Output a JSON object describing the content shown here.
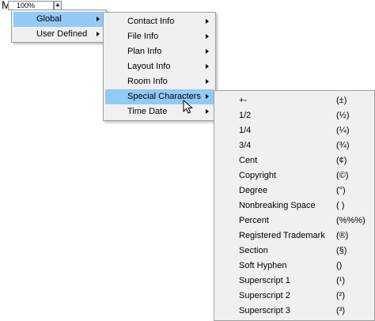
{
  "toolbar": {
    "glyph": "M",
    "zoom_value": "100%",
    "spin_glyph": "▲"
  },
  "menus": {
    "level1": {
      "items": [
        {
          "label": "Global",
          "highlighted": true,
          "submenu": true
        },
        {
          "label": "User Defined",
          "highlighted": false,
          "submenu": true
        }
      ]
    },
    "level2": {
      "items": [
        {
          "label": "Contact Info",
          "highlighted": false,
          "submenu": true
        },
        {
          "label": "File Info",
          "highlighted": false,
          "submenu": true
        },
        {
          "label": "Plan Info",
          "highlighted": false,
          "submenu": true
        },
        {
          "label": "Layout Info",
          "highlighted": false,
          "submenu": true
        },
        {
          "label": "Room Info",
          "highlighted": false,
          "submenu": true
        },
        {
          "label": "Special Characters",
          "highlighted": true,
          "submenu": true
        },
        {
          "label": "Time  Date",
          "highlighted": false,
          "submenu": true
        }
      ]
    },
    "level3": {
      "items": [
        {
          "label": "+-",
          "value": "(±)"
        },
        {
          "label": "1/2",
          "value": "(½)"
        },
        {
          "label": "1/4",
          "value": "(¼)"
        },
        {
          "label": "3/4",
          "value": "(¾)"
        },
        {
          "label": "Cent",
          "value": "(¢)"
        },
        {
          "label": "Copyright",
          "value": "(©)"
        },
        {
          "label": "Degree",
          "value": "(°)"
        },
        {
          "label": "Nonbreaking Space",
          "value": "( )"
        },
        {
          "label": "Percent",
          "value": "(%%%)"
        },
        {
          "label": "Registered Trademark",
          "value": "(®)"
        },
        {
          "label": "Section",
          "value": "(§)"
        },
        {
          "label": "Soft Hyphen",
          "value": "()"
        },
        {
          "label": "Superscript 1",
          "value": "(¹)"
        },
        {
          "label": "Superscript 2",
          "value": "(²)"
        },
        {
          "label": "Superscript 3",
          "value": "(³)"
        }
      ]
    }
  },
  "colors": {
    "menu_bg": "#f0f0f0",
    "highlight": "#91c9f7",
    "border": "#a0a0a0"
  },
  "icons": {
    "submenu_arrow": "submenu-arrow-icon",
    "cursor": "mouse-pointer-icon"
  }
}
